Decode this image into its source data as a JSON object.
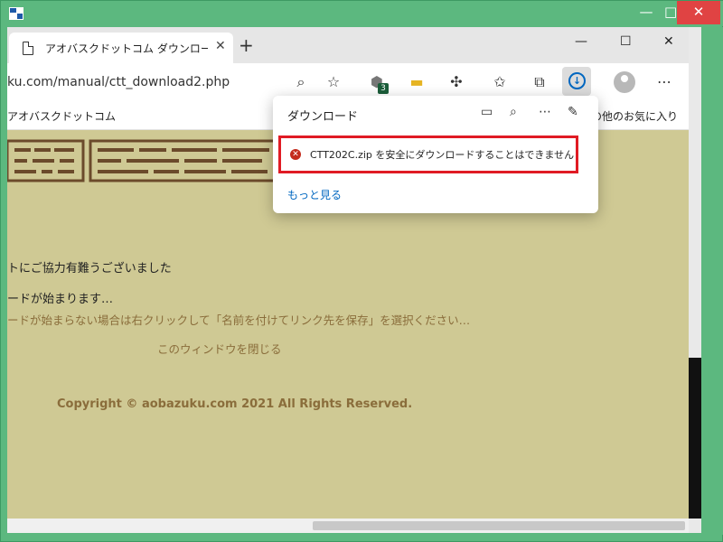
{
  "window": {
    "min_label": "—",
    "max_label": "□",
    "close_label": "✕"
  },
  "tab": {
    "title": "アオバスクドットコム ダウンロード有難",
    "close_label": "✕",
    "new_tab_label": "+"
  },
  "window_controls": {
    "min": "—",
    "max": "☐",
    "close": "✕"
  },
  "address": {
    "url": "ku.com/manual/ctt_download2.php"
  },
  "extensions": {
    "badge": "3"
  },
  "bookmarks": {
    "left": "アオバスクドットコム",
    "right": "その他のお気に入り"
  },
  "page": {
    "thanks": "トにご協力有難うございました",
    "starting": "ードが始まります…",
    "hint": "ードが始まらない場合は右クリックして「名前を付けてリンク先を保存」を選択ください…",
    "close_window": "このウィンドウを閉じる",
    "copyright": "Copyright © aobazuku.com 2021 All Rights Reserved."
  },
  "downloads": {
    "title": "ダウンロード",
    "item_message": "CTT202C.zip を安全にダウンロードすることはできません",
    "more_link": "もっと見る"
  },
  "colors": {
    "page_bg": "#cfc994",
    "error_border": "#e01b24",
    "link": "#0067c0"
  }
}
